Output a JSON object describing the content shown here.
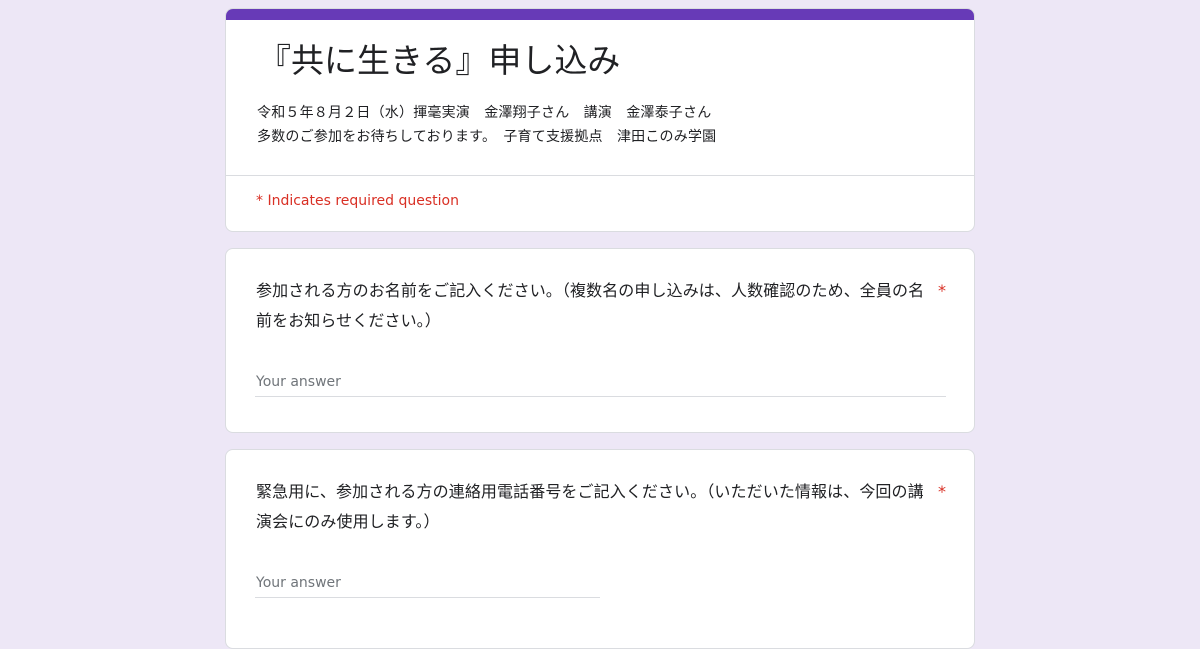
{
  "form": {
    "accent_color": "#673ab7",
    "background_color": "#ede7f6",
    "required_color": "#d93025",
    "title": "『共に生きる』申し込み",
    "description_lines": [
      "令和５年８月２日（水）揮毫実演　金澤翔子さん　講演　金澤泰子さん",
      "多数のご参加をお待ちしております。　子育て支援拠点　津田このみ学園"
    ],
    "required_note": "* Indicates required question"
  },
  "questions": [
    {
      "title": "参加される方のお名前をご記入ください。（複数名の申し込みは、人数確認のため、全員の名前をお知らせください。）",
      "required_mark": "*",
      "placeholder": "Your answer"
    },
    {
      "title": "緊急用に、参加される方の連絡用電話番号をご記入ください。（いただいた情報は、今回の講演会にのみ使用します。）",
      "required_mark": "*",
      "placeholder": "Your answer"
    }
  ]
}
